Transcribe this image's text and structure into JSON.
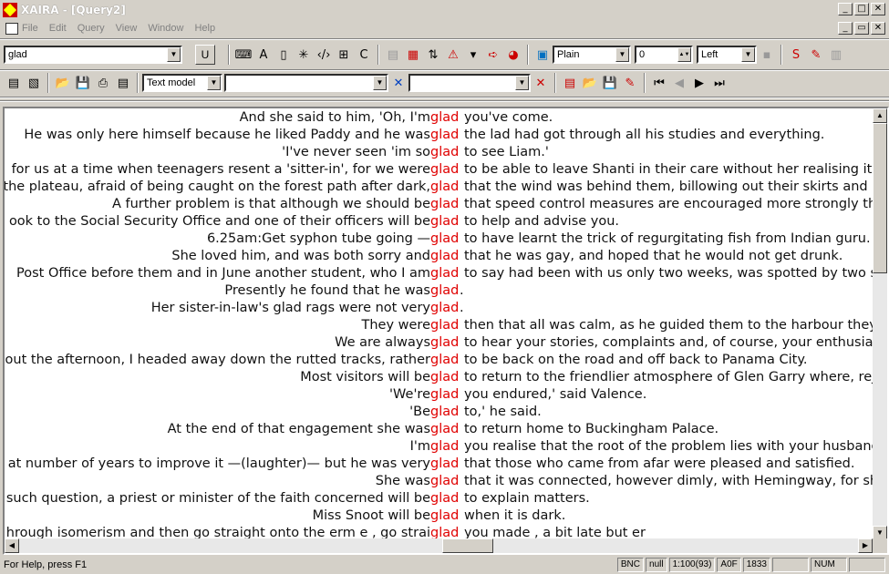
{
  "window": {
    "title": "XAIRA - [Query2]"
  },
  "menu": {
    "items": [
      "File",
      "Edit",
      "Query",
      "View",
      "Window",
      "Help"
    ]
  },
  "toolbar1": {
    "query_value": "glad",
    "u_label": "U",
    "style_select": "Plain",
    "size_value": "0",
    "align_select": "Left"
  },
  "toolbar2": {
    "mode_select": "Text model",
    "filter1_value": "",
    "filter2_value": ""
  },
  "concordance": {
    "keyword": "glad",
    "lines": [
      {
        "left": "And she said to him, 'Oh, I'm",
        "right": "you've come."
      },
      {
        "left": "He was only here himself because he liked Paddy and he was",
        "right": "the lad had got through all his studies and everything."
      },
      {
        "left": "'I've never seen 'im so",
        "right": "to see Liam.'"
      },
      {
        "left": "for us at a time when teenagers resent a 'sitter-in', for we were",
        "right": "to be able to leave Shanti in their care without her realising it –"
      },
      {
        "left": "the plateau, afraid of being caught on the forest path after dark,",
        "right": "that the wind was behind them, billowing out their skirts and pr"
      },
      {
        "left": "A further problem is that although we should be",
        "right": "that speed control measures are encouraged more strongly tha"
      },
      {
        "left": "ook to the Social Security Office and one of their officers will be",
        "right": "to help and advise you."
      },
      {
        "left": "6.25am:Get syphon tube going —",
        "right": "to have learnt the trick of regurgitating fish from Indian guru."
      },
      {
        "left": "She loved him, and was both sorry and",
        "right": "that he was gay, and hoped that he would not get drunk."
      },
      {
        "left": "Post Office before them and in June another student, who I am",
        "right": "to say had been with us only two weeks, was spotted by two se"
      },
      {
        "left": "Presently he found that he was",
        "right": "."
      },
      {
        "left": "Her sister-in-law's glad rags were not very",
        "right": "."
      },
      {
        "left": "They were",
        "right": "then that all was calm, as he guided them to the harbour they c"
      },
      {
        "left": "We are always",
        "right": "to hear your stories, complaints and, of course, your enthusia"
      },
      {
        "left": "hout the afternoon, I headed away down the rutted tracks, rather",
        "right": "to be back on the road and off back to Panama City."
      },
      {
        "left": "Most visitors will be",
        "right": "to return to the friendlier atmosphere of Glen Garry where, rejo"
      },
      {
        "left": "'We're",
        "right": "you endured,' said Valence."
      },
      {
        "left": "'Be",
        "right": "to,' he said."
      },
      {
        "left": "At the end of that engagement she was",
        "right": "to return home to Buckingham Palace."
      },
      {
        "left": "I'm",
        "right": "you realise that the root of the problem lies with your husband"
      },
      {
        "left": "at number of years to improve it —(laughter)— but he was very",
        "right": "that those who came from afar were pleased and satisfied."
      },
      {
        "left": "She was",
        "right": "that it was connected, however dimly, with Hemingway, for she"
      },
      {
        "left": "such question, a priest or minister of the faith concerned will be",
        "right": "to explain matters."
      },
      {
        "left": "Miss Snoot will be",
        "right": "when it is dark."
      },
      {
        "left": "hrough isomerism and then go straight onto the erm e , go strai",
        "right": "you made , a bit late but er"
      }
    ]
  },
  "status": {
    "help": "For Help, press F1",
    "corpus": "BNC",
    "null": "null",
    "ratio": "1:100(93)",
    "code": "A0F",
    "number": "1833",
    "empty": "",
    "num": "NUM"
  }
}
